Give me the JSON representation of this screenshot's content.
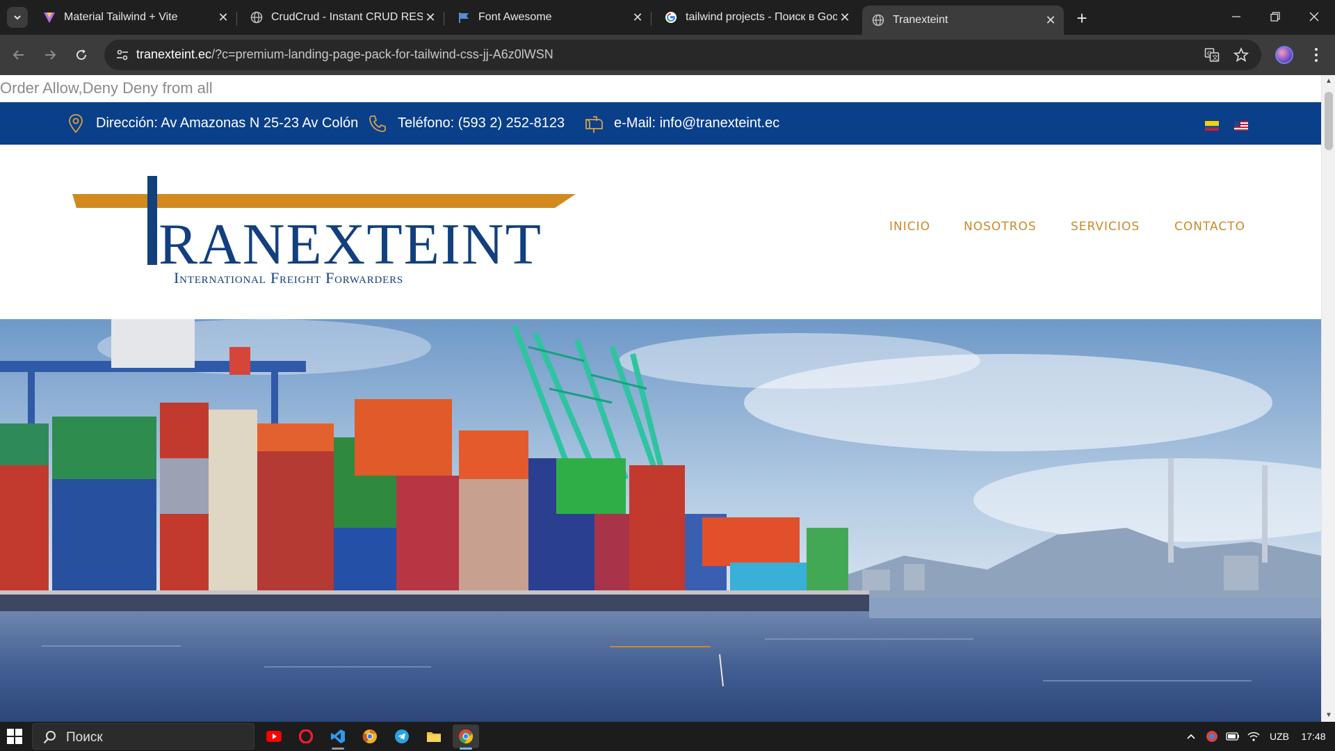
{
  "browser": {
    "tabs": [
      {
        "title": "Material Tailwind + Vite",
        "icon": "material-tailwind-icon",
        "active": false
      },
      {
        "title": "CrudCrud - Instant CRUD REST",
        "icon": "globe-icon",
        "active": false
      },
      {
        "title": "Font Awesome",
        "icon": "font-awesome-flag-icon",
        "active": false
      },
      {
        "title": "tailwind projects - Поиск в Goo",
        "icon": "google-icon",
        "active": false
      },
      {
        "title": "Tranexteint",
        "icon": "globe-icon",
        "active": true
      }
    ],
    "address": {
      "host": "tranexteint.ec",
      "path": "/?c=premium-landing-page-pack-for-tailwind-css-jj-A6z0lWSN"
    }
  },
  "page": {
    "error_text": "Order Allow,Deny Deny from all",
    "infobar": {
      "address": "Dirección: Av Amazonas N 25-23 Av Colón",
      "phone": "Teléfono: (593 2) 252-8123",
      "email": "e-Mail: info@tranexteint.ec",
      "languages": [
        "es",
        "en"
      ]
    },
    "logo": {
      "name": "TRANEXTEINT",
      "tagline": "International Freight Forwarders"
    },
    "nav": [
      "INICIO",
      "NOSOTROS",
      "SERVICIOS",
      "CONTACTO"
    ],
    "colors": {
      "infobar_bg": "#0a3f8a",
      "nav_text": "#c98a2a",
      "logo_blue": "#123f7e",
      "logo_orange": "#d28a1e"
    }
  },
  "taskbar": {
    "search_placeholder": "Поиск",
    "apps": [
      "youtube-icon",
      "opera-icon",
      "vscode-icon",
      "chrome-canary-icon",
      "telegram-icon",
      "file-explorer-icon",
      "chrome-icon"
    ],
    "language": "UZB",
    "time": "17:48"
  }
}
